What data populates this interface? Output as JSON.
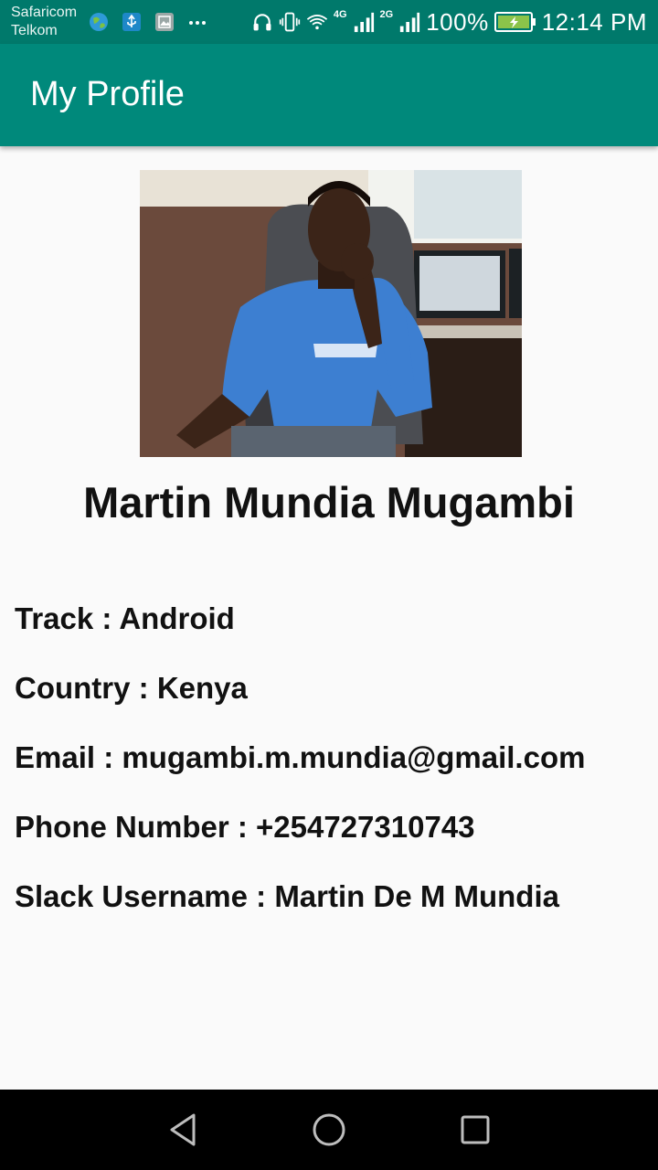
{
  "status_bar": {
    "carriers": [
      "Safaricom",
      "Telkom"
    ],
    "left_icons": [
      "globe-icon",
      "usb-icon",
      "image-icon",
      "more-icon"
    ],
    "network_4g": "4G",
    "network_2g": "2G",
    "battery": "100%",
    "time": "12:14 PM"
  },
  "app_bar": {
    "title": "My Profile",
    "color": "#00897b"
  },
  "profile": {
    "photo_alt": "profile-photo",
    "name": "Martin Mundia Mugambi",
    "details": [
      {
        "text": "Track : Android"
      },
      {
        "text": "Country : Kenya"
      },
      {
        "text": "Email : mugambi.m.mundia@gmail.com"
      },
      {
        "text": "Phone Number : +254727310743"
      },
      {
        "text": "Slack Username : Martin De M Mundia"
      }
    ]
  },
  "nav_bar": {
    "buttons": [
      "back-icon",
      "home-icon",
      "recents-icon"
    ]
  }
}
